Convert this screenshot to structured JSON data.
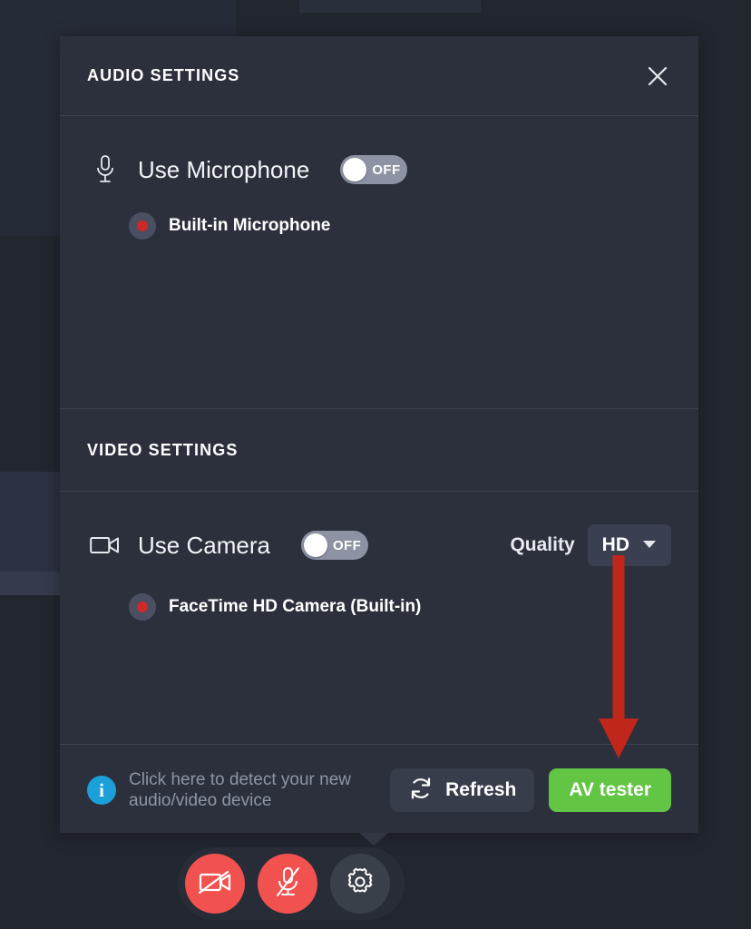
{
  "panel": {
    "audio_section_title": "AUDIO SETTINGS",
    "video_section_title": "VIDEO SETTINGS",
    "close_icon": "close-icon"
  },
  "audio": {
    "mic_icon": "microphone-icon",
    "use_label": "Use Microphone",
    "toggle_state": "OFF",
    "devices": [
      {
        "label": "Built-in Microphone",
        "selected": true
      }
    ]
  },
  "video": {
    "camera_icon": "video-camera-icon",
    "use_label": "Use Camera",
    "toggle_state": "OFF",
    "quality_label": "Quality",
    "quality_value": "HD",
    "quality_options": [
      "HD"
    ],
    "devices": [
      {
        "label": "FaceTime HD Camera (Built-in)",
        "selected": true
      }
    ]
  },
  "footer": {
    "info_icon": "info-icon",
    "info_glyph": "i",
    "hint_line1": "Click here to detect your new",
    "hint_line2": "audio/video device",
    "refresh_label": "Refresh",
    "refresh_icon": "refresh-icon",
    "av_tester_label": "AV tester"
  },
  "controls": [
    {
      "name": "camera-off-button",
      "icon": "video-camera-off-icon",
      "style": "red"
    },
    {
      "name": "mic-off-button",
      "icon": "microphone-off-icon",
      "style": "red"
    },
    {
      "name": "settings-button",
      "icon": "gear-icon",
      "style": "grey"
    }
  ],
  "annotation": {
    "type": "arrow",
    "color": "#c0261a",
    "points_from": "quality-select",
    "points_to": "av-tester-button"
  },
  "colors": {
    "background": "#22262f",
    "panel": "#2b303c",
    "accent_green": "#63c544",
    "accent_red": "#f1524f",
    "info_blue": "#1b9fd8",
    "radio_red": "#cf2828",
    "annotation_red": "#c0261a"
  }
}
